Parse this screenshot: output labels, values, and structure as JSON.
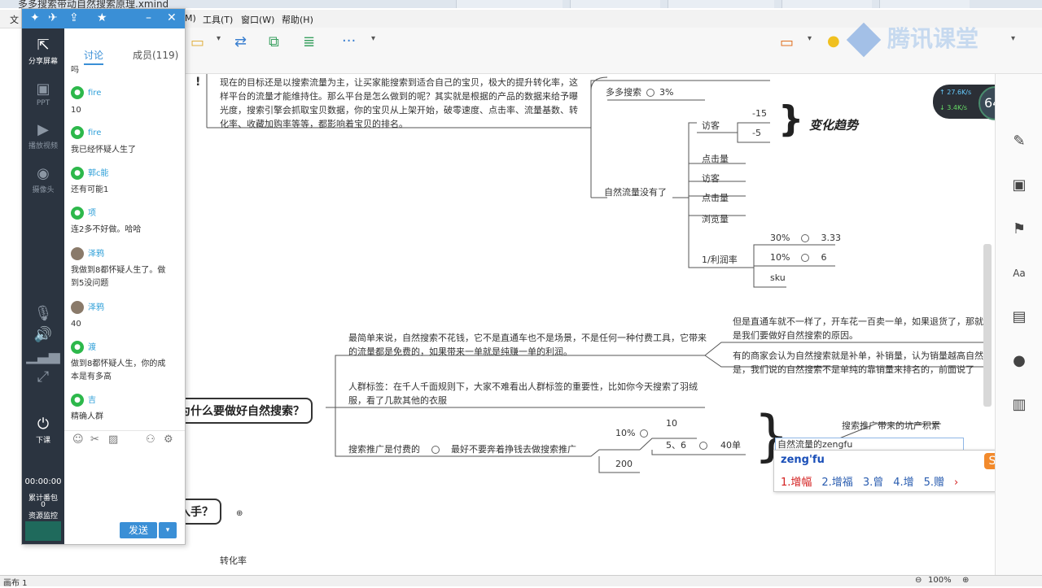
{
  "window": {
    "title": "多多搜索带动自然搜索原理.xmind"
  },
  "menubar": {
    "items": [
      "M)",
      "工具(T)",
      "窗口(W)",
      "帮助(H)"
    ],
    "left_fragment": "文"
  },
  "chat_panel": {
    "tabs": {
      "discussion": "讨论",
      "members": "成员(119)"
    },
    "sidebar": {
      "share_screen": "分享屏幕",
      "ppt": "PPT",
      "play_video": "播放视频",
      "camera": "摄像头",
      "end_class": "下课",
      "timer": "00:00:00",
      "gift_label": "累计番包",
      "gift_count": "0",
      "resource_monitor": "资源监控"
    },
    "messages": [
      {
        "user": "",
        "text": "吗"
      },
      {
        "user": "fire",
        "text": "10"
      },
      {
        "user": "fire",
        "text": "我已经怀疑人生了"
      },
      {
        "user": "郭c能",
        "text": "还有可能1"
      },
      {
        "user": "项",
        "text": "连2多不好做。哈哈"
      },
      {
        "user": "泽鸦",
        "text": "我做到8都怀疑人生了。做到5没问题"
      },
      {
        "user": "泽鸦",
        "text": "40"
      },
      {
        "user": "渡",
        "text": "做到8都怀疑人生，你的成本是有多高"
      },
      {
        "user": "吉",
        "text": "精确人群"
      }
    ],
    "send_label": "发送",
    "send_arrow": "▾"
  },
  "mindmap": {
    "intro_text": "现在的目标还是以搜索流量为主，让买家能搜索到适合自己的宝贝，极大的提升转化率，这样平台的流量才能维持住。那么平台是怎么做到的呢？其实就是根据的产品的数据来给予曝光度，搜索引擎会抓取宝贝数据，你的宝贝从上架开始，破零速度、点击率、流量基数、转化率、收藏加购率等等，都影响着宝贝的排名。",
    "duoduo_search": "多多搜索",
    "duoduo_pct": "3%",
    "visitors": "访客",
    "v1": "-15",
    "v2": "-5",
    "trend": "变化趋势",
    "clicks": "点击量",
    "no_natural": "自然流量没有了",
    "visitors2": "访客",
    "clicks2": "点击量",
    "views": "浏览量",
    "profit": "1/利润率",
    "p30": "30%",
    "p333": "3.33",
    "p10": "10%",
    "p6": "6",
    "sku": "sku",
    "why_topic": "为什么要做好自然搜索？",
    "simple_text": "最简单来说，自然搜索不花钱，它不是直通车也不是场景，不是任何一种付费工具，它带来的流量都是免费的，如果带来一单就是纯赚一单的利润。",
    "but_text": "但是直通车就不一样了，开车花一百卖一单，如果退货了，那就是我们要做好自然搜索的原因。",
    "merchant_text": "有的商家会认为自然搜索就是补单，补销量，认为销量越高自然是，我们说的自然搜索不是单纯的靠销量来排名的，前面说了",
    "crowd_text": "人群标签：在千人千面规则下，大家不难看出人群标签的重要性，比如你今天搜索了羽绒服，看了几款其他的衣服",
    "paid_text": "搜索推广是付费的",
    "dont_text": "最好不要奔着挣钱去做搜索推广",
    "n10pct": "10%",
    "n10": "10",
    "n56": "5、6",
    "n40": "40单",
    "n200": "200",
    "pit_text": "搜索推广带来的坑产积累",
    "editing": "自然流量的zengfu",
    "start_topic": "入手？",
    "conversion": "转化率",
    "excl": "!"
  },
  "ime": {
    "composition": "zeng'fu",
    "candidates": [
      "1.增幅",
      "2.增福",
      "3.曾",
      "4.增",
      "5.赠"
    ],
    "more": "›"
  },
  "network": {
    "up": "27.6",
    "down": "3.4",
    "unit": "K/s",
    "percent": "64",
    "percent_sign": "%"
  },
  "watermark": "腾讯课堂",
  "statusbar": {
    "left": "画布 1",
    "zoom": "100%",
    "minus": "⊖",
    "plus": "⊕"
  }
}
